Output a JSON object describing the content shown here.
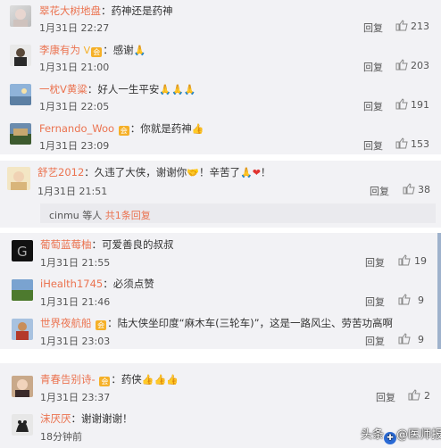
{
  "comments": [
    {
      "name": "翠花大树地盘",
      "sep": "：",
      "text": "药神还是药神",
      "time": "1月31日 22:27",
      "reply": "回复",
      "likes": "213",
      "emoji": ""
    },
    {
      "name": "李康有为",
      "sep": "：",
      "text": "感谢",
      "time": "1月31日 21:00",
      "reply": "回复",
      "likes": "203",
      "emoji": "🙏"
    },
    {
      "name": "一枕V黄粱",
      "sep": "：",
      "text": "好人一生平安",
      "time": "1月31日 22:05",
      "reply": "回复",
      "likes": "191",
      "emoji": "🙏🙏🙏"
    },
    {
      "name": "Fernando_Woo",
      "sep": "：",
      "text": "你就是药神",
      "time": "1月31日 23:09",
      "reply": "回复",
      "likes": "153",
      "emoji": "👍"
    },
    {
      "name": "舒艺2012",
      "sep": "：",
      "text": "久违了大侠，谢谢你",
      "text2": "！辛苦了",
      "text3": "！",
      "time": "1月31日 21:51",
      "reply": "回复",
      "likes": "38"
    },
    {
      "name": "葡萄蓝莓柚",
      "sep": "：",
      "text": "可爱善良的叔叔",
      "time": "1月31日 21:55",
      "reply": "回复",
      "likes": "19"
    },
    {
      "name": "iHealth1745",
      "sep": "：",
      "text": "必须点赞",
      "time": "1月31日 21:46",
      "reply": "回复",
      "likes": "9"
    },
    {
      "name": "世界夜航船",
      "sep": "：",
      "text": "陆大侠坐印度“麻木车(三轮车)”，这是一路风尘、劳苦功高啊",
      "time": "1月31日 23:03",
      "reply": "回复",
      "likes": "9"
    },
    {
      "name": "青春告别诗-",
      "sep": "：",
      "text": "药侠",
      "time": "1月31日 23:37",
      "reply": "回复",
      "likes": "2",
      "emoji": "👍👍👍"
    },
    {
      "name": "沫厌厌",
      "sep": "：",
      "text": "谢谢谢谢！",
      "time": "18分钟前"
    }
  ],
  "subreplies": {
    "user": "cinmu",
    "mid": " 等人 ",
    "link": "共1条回复"
  },
  "watermark": {
    "prefix": "头条",
    "handle": "@医师报"
  },
  "colors": {
    "name": "#eb7350",
    "background": "#f2f2f5"
  }
}
